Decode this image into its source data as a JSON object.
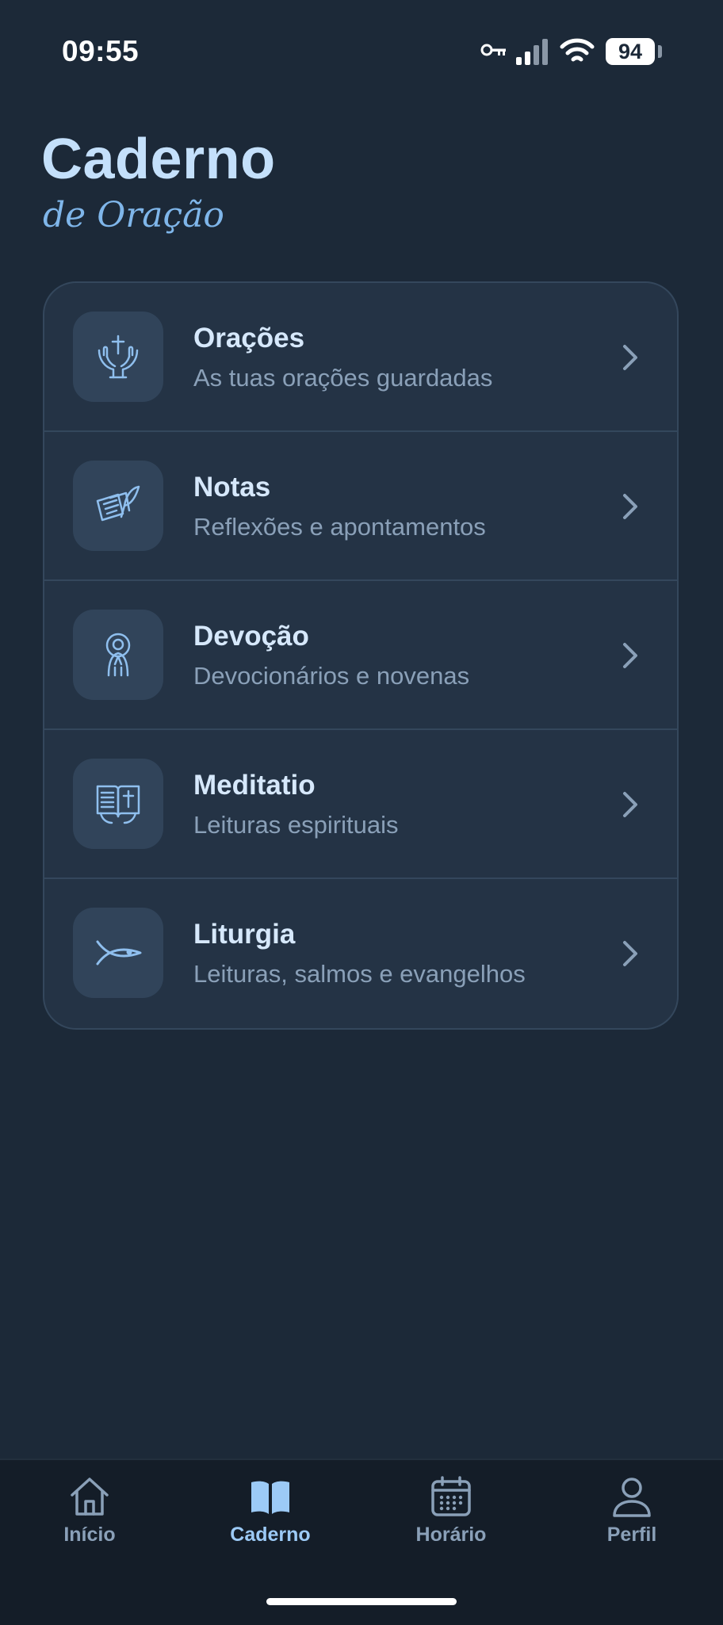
{
  "status": {
    "time": "09:55",
    "battery": "94"
  },
  "header": {
    "title": "Caderno",
    "subtitle": "de Oração"
  },
  "menu": [
    {
      "title": "Orações",
      "subtitle": "As tuas orações guardadas",
      "icon": "praying-hands-cross-icon"
    },
    {
      "title": "Notas",
      "subtitle": "Reflexões e apontamentos",
      "icon": "notes-quill-icon"
    },
    {
      "title": "Devoção",
      "subtitle": "Devocionários e novenas",
      "icon": "praying-figure-icon"
    },
    {
      "title": "Meditatio",
      "subtitle": "Leituras espirituais",
      "icon": "open-bible-icon"
    },
    {
      "title": "Liturgia",
      "subtitle": "Leituras, salmos e evangelhos",
      "icon": "ichthys-fish-icon"
    }
  ],
  "nav": [
    {
      "label": "Início",
      "icon": "home-icon",
      "active": false
    },
    {
      "label": "Caderno",
      "icon": "book-icon",
      "active": true
    },
    {
      "label": "Horário",
      "icon": "calendar-icon",
      "active": false
    },
    {
      "label": "Perfil",
      "icon": "user-icon",
      "active": false
    }
  ],
  "colors": {
    "background": "#1c2938",
    "accent": "#9ccaf6",
    "card": "#243345"
  }
}
